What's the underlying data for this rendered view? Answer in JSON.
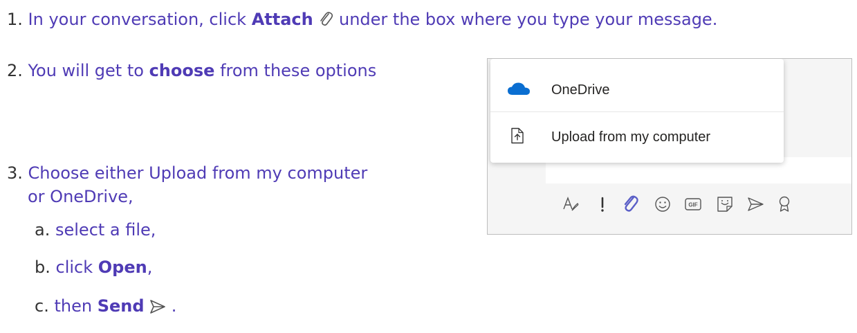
{
  "steps": [
    {
      "num": "1.",
      "before": "In your conversation, click ",
      "bold": "Attach",
      "after": " under the box where you type your message."
    },
    {
      "num": "2.",
      "before": "You will get to ",
      "bold": "choose",
      "after": " from these options"
    },
    {
      "num": "3.",
      "line1": "Choose either Upload from my computer",
      "line2": "or OneDrive,"
    }
  ],
  "substeps": [
    {
      "letter": "a.",
      "text": "select a file,"
    },
    {
      "letter": "b.",
      "before": "click ",
      "bold": "Open",
      "after": ","
    },
    {
      "letter": "c.",
      "before": "then ",
      "bold": "Send",
      "after": " ."
    }
  ],
  "menu": {
    "items": [
      {
        "label": "OneDrive",
        "icon": "onedrive-cloud-icon"
      },
      {
        "label": "Upload from my computer",
        "icon": "upload-file-icon"
      }
    ]
  },
  "toolbar_icons": [
    "format-icon",
    "important-icon",
    "attach-icon",
    "emoji-icon",
    "gif-icon",
    "sticker-icon",
    "send-icon",
    "praise-icon"
  ],
  "toolbar": {
    "gif_text": "GIF"
  },
  "colors": {
    "text": "#4f3bb5",
    "number": "#333333",
    "onedrive": "#0a6ed1",
    "attach_active": "#5b5fc7"
  }
}
